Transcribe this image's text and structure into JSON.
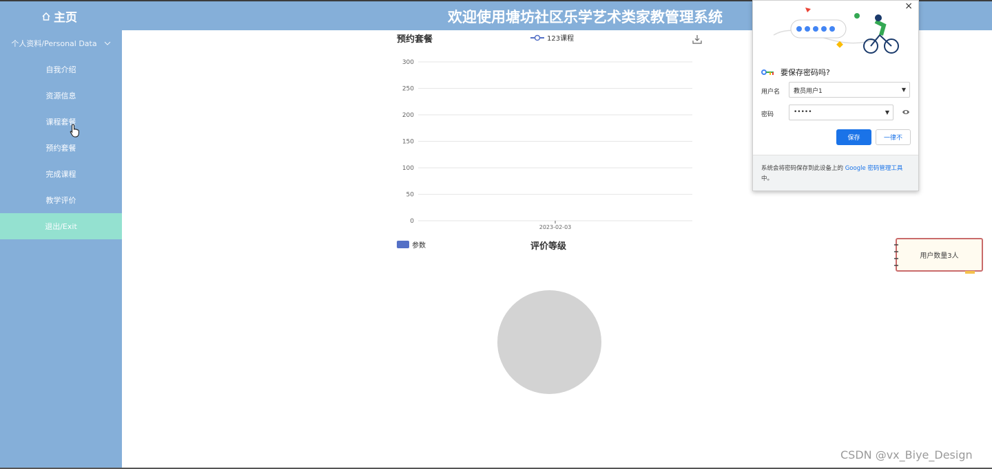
{
  "header": {
    "home_label": "主页",
    "site_title": "欢迎使用塘坊社区乐学艺术类家教管理系统"
  },
  "sidebar": {
    "group_label": "个人资料/Personal Data",
    "items": [
      {
        "label": "自我介绍"
      },
      {
        "label": "资源信息"
      },
      {
        "label": "课程套餐"
      },
      {
        "label": "预约套餐"
      },
      {
        "label": "完成课程"
      },
      {
        "label": "教学评价"
      },
      {
        "label": "退出/Exit"
      }
    ]
  },
  "chart_data": [
    {
      "type": "bar",
      "title": "预约套餐",
      "legend": [
        "123课程"
      ],
      "legend_position": "top-center",
      "categories": [
        "2023-02-03"
      ],
      "series": [
        {
          "name": "123课程",
          "values": [
            0
          ]
        }
      ],
      "ylim": [
        0,
        300
      ],
      "yticks": [
        "0",
        "50",
        "100",
        "150",
        "200",
        "250",
        "300"
      ],
      "grid": true
    },
    {
      "type": "pie",
      "title": "评价等级",
      "legend": [
        "参数"
      ],
      "legend_position": "top-left",
      "values": []
    }
  ],
  "colors": {
    "sidebar_bg": "#85afd9",
    "active_item_bg": "#94e1d0",
    "series_color": "#5470c6",
    "save_button": "#1a73e8"
  },
  "password_popup": {
    "close_glyph": "×",
    "heading": "要保存密码吗?",
    "username_label": "用户名",
    "username_value": "教员用户1",
    "password_label": "密码",
    "password_value": "•••••",
    "save_label": "保存",
    "never_label": "一律不",
    "footer_text": "系统会将密码保存到此设备上的",
    "footer_link": "Google 密码管理工具",
    "footer_suffix": "中。"
  },
  "note": {
    "text": "用户数量3人"
  },
  "watermark": "CSDN @vx_Biye_Design"
}
